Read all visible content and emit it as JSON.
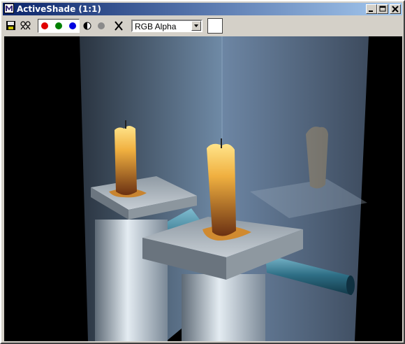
{
  "window": {
    "title": "ActiveShade (1:1)"
  },
  "title_controls": {
    "minimize_icon": "minimize-icon",
    "maximize_icon": "maximize-icon",
    "close_icon": "close-icon"
  },
  "toolbar": {
    "save_icon": "save-icon",
    "clone_icon": "clone-render-icon",
    "channels": [
      {
        "name": "red-channel",
        "color": "#e00000"
      },
      {
        "name": "green-channel",
        "color": "#008000"
      },
      {
        "name": "blue-channel",
        "color": "#0000e0"
      }
    ],
    "alpha_icon": "alpha-channel-icon",
    "mono_icon": "monochrome-icon",
    "clear_icon": "clear-icon",
    "channel_select": {
      "value": "RGB Alpha"
    },
    "color_swatch": "#ffffff"
  },
  "viewport": {
    "content": "rendered-scene"
  }
}
